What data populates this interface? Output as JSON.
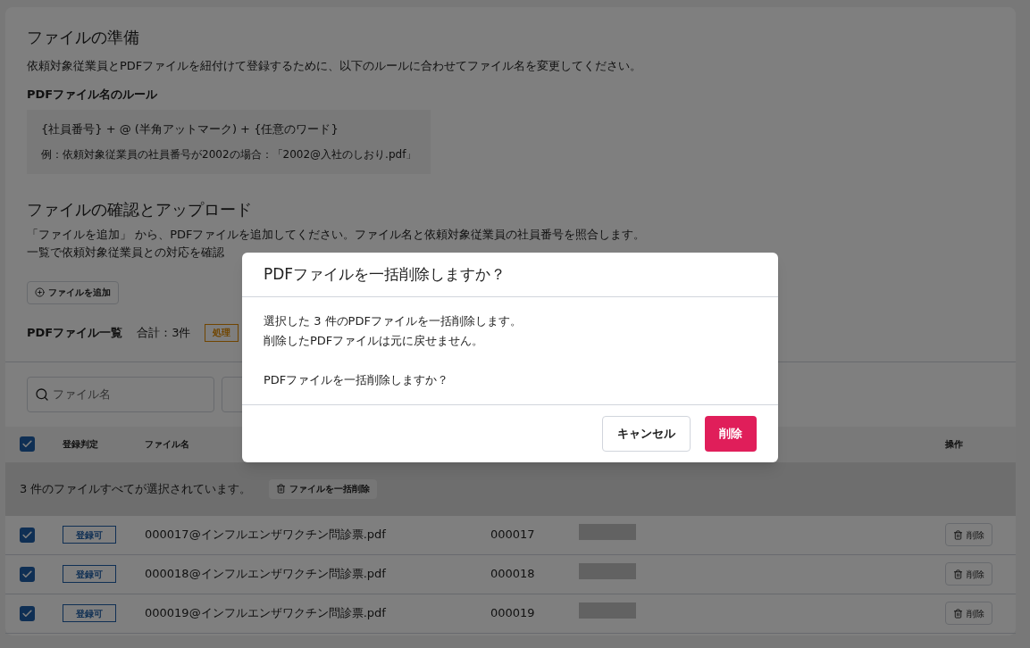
{
  "prepare": {
    "title": "ファイルの準備",
    "description": "依頼対象従業員とPDFファイルを紐付けて登録するために、以下のルールに合わせてファイル名を変更してください。",
    "rule_title": "PDFファイル名のルール",
    "rule_formula": "{社員番号} + @ (半角アットマーク) + {任意のワード}",
    "rule_example": "例：依頼対象従業員の社員番号が2002の場合：「2002@入社のしおり.pdf」"
  },
  "upload": {
    "title": "ファイルの確認とアップロード",
    "description_lines": [
      "「ファイルを追加」 から、PDFファイルを追加してください。ファイル名と依頼対象従業員の社員番号を照合します。",
      "一覧で依頼対象従業員との対応を確認"
    ],
    "add_button": "ファイルを追加",
    "list_title": "PDFファイル一覧",
    "total": "合計：3件",
    "status_badge": "処理"
  },
  "search": {
    "placeholder": "ファイル名"
  },
  "table": {
    "select_all_checked": true,
    "columns": [
      "登録判定",
      "ファイル名",
      "操作"
    ],
    "selection_banner": {
      "text": "3 件のファイルすべてが選択されています。",
      "button": "ファイルを一括削除"
    },
    "rows": [
      {
        "checked": true,
        "status": "登録可",
        "file_name": "000017@インフルエンザワクチン問診票.pdf",
        "employee_no": "000017",
        "action": "削除"
      },
      {
        "checked": true,
        "status": "登録可",
        "file_name": "000018@インフルエンザワクチン問診票.pdf",
        "employee_no": "000018",
        "action": "削除"
      },
      {
        "checked": true,
        "status": "登録可",
        "file_name": "000019@インフルエンザワクチン問診票.pdf",
        "employee_no": "000019",
        "action": "削除"
      }
    ]
  },
  "dialog": {
    "title": "PDFファイルを一括削除しますか？",
    "body": [
      "選択した 3 件のPDFファイルを一括削除します。",
      "削除したPDFファイルは元に戻せません。"
    ],
    "question": "PDFファイルを一括削除しますか？",
    "cancel": "キャンセル",
    "confirm": "削除"
  }
}
